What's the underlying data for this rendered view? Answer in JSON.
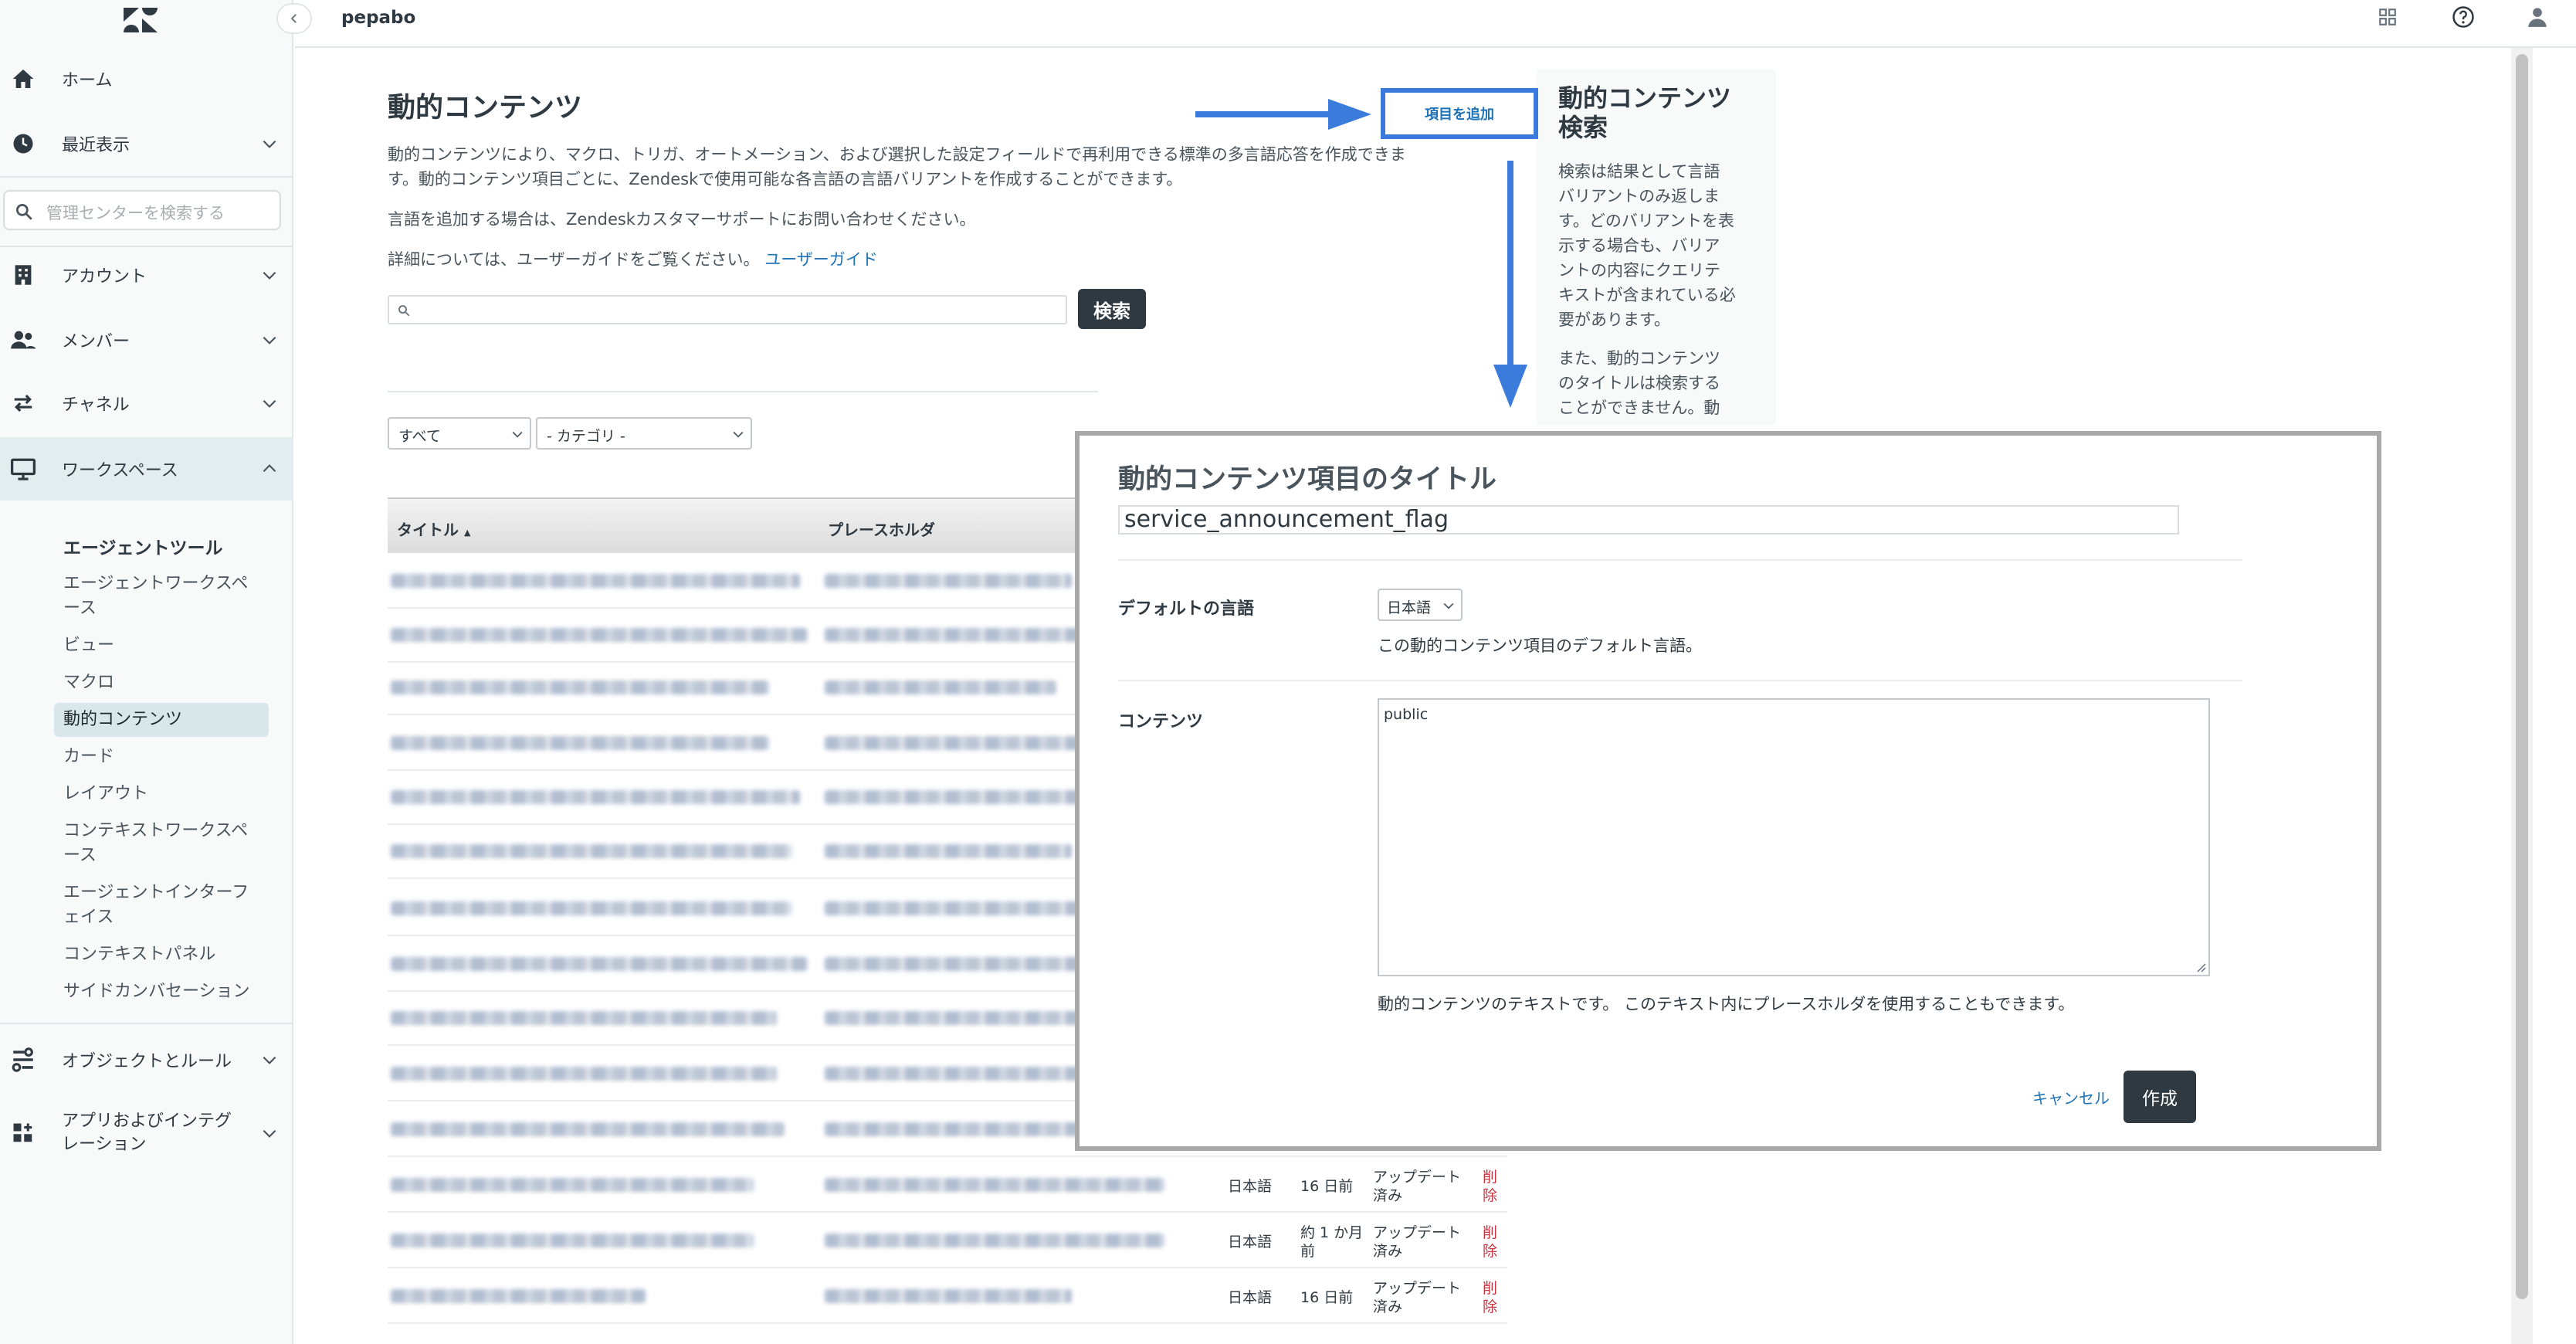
{
  "topbar": {
    "brand": "pepabo"
  },
  "sidebar": {
    "search_placeholder": "管理センターを検索する",
    "nav": {
      "home": "ホーム",
      "recent": "最近表示",
      "account": "アカウント",
      "members": "メンバー",
      "channels": "チャネル",
      "workspaces": "ワークスペース",
      "objects": "オブジェクトとルール",
      "apps_l1": "アプリおよびインテグ",
      "apps_l2": "レーション"
    },
    "subnav": {
      "title": "エージェントツール",
      "items": [
        "エージェントワークスペ",
        "ース",
        "ビュー",
        "マクロ",
        "動的コンテンツ",
        "カード",
        "レイアウト",
        "コンテキストワークスペ",
        "ース",
        "エージェントインターフ",
        "ェイス",
        "コンテキストパネル",
        "サイドカンバセーション"
      ]
    }
  },
  "main": {
    "title": "動的コンテンツ",
    "desc_line1": "動的コンテンツにより、マクロ、トリガ、オートメーション、および選択した設定フィールドで再利用できる標準の多言語応答を作成できま",
    "desc_line2": "す。動的コンテンツ項目ごとに、Zendeskで使用可能な各言語の言語バリアントを作成することができます。",
    "lang_note": "言語を追加する場合は、Zendeskカスタマーサポートにお問い合わせください。",
    "guide_prefix": "詳細については、ユーザーガイドをご覧ください。",
    "guide_link": "ユーザーガイド",
    "search_button": "検索",
    "add_item_button": "項目を追加",
    "filter_all": "すべて",
    "filter_category": "- カテゴリ -",
    "table": {
      "col_title": "タイトル",
      "col_title_sort": "▲",
      "col_placeholder": "プレースホルダ",
      "rows": [
        {
          "lang": "日本語",
          "updated": "16 日前",
          "status_l1": "アップデート",
          "status_l2": "済み",
          "del_l1": "削",
          "del_l2": "除"
        },
        {
          "lang": "日本語",
          "updated_l1": "約 1 か月",
          "updated_l2": "前",
          "status_l1": "アップデート",
          "status_l2": "済み",
          "del_l1": "削",
          "del_l2": "除"
        },
        {
          "lang": "日本語",
          "updated": "16 日前",
          "status_l1": "アップデート",
          "status_l2": "済み",
          "del_l1": "削",
          "del_l2": "除"
        }
      ]
    }
  },
  "help": {
    "title_l1": "動的コンテンツ",
    "title_l2": "検索",
    "body_lines": [
      "検索は結果として言語",
      "バリアントのみ返しま",
      "す。どのバリアントを表",
      "示する場合も、バリア",
      "ントの内容にクエリテ",
      "キストが含まれている必",
      "要があります。"
    ],
    "body2_lines": [
      "また、動的コンテンツ",
      "のタイトルは検索する",
      "ことができません。動"
    ]
  },
  "modal": {
    "title": "動的コンテンツ項目のタイトル",
    "title_value": "service_announcement_flag",
    "default_lang_label": "デフォルトの言語",
    "default_lang_value": "日本語",
    "default_lang_hint": "この動的コンテンツ項目のデフォルト言語。",
    "content_label": "コンテンツ",
    "content_value": "public",
    "content_hint": "動的コンテンツのテキストです。 このテキスト内にプレースホルダを使用することもできます。",
    "cancel": "キャンセル",
    "create": "作成"
  },
  "colors": {
    "accent": "#3b7bdc",
    "link": "#1f73b7",
    "dark_button": "#2f3941",
    "delete": "#cc3340"
  }
}
